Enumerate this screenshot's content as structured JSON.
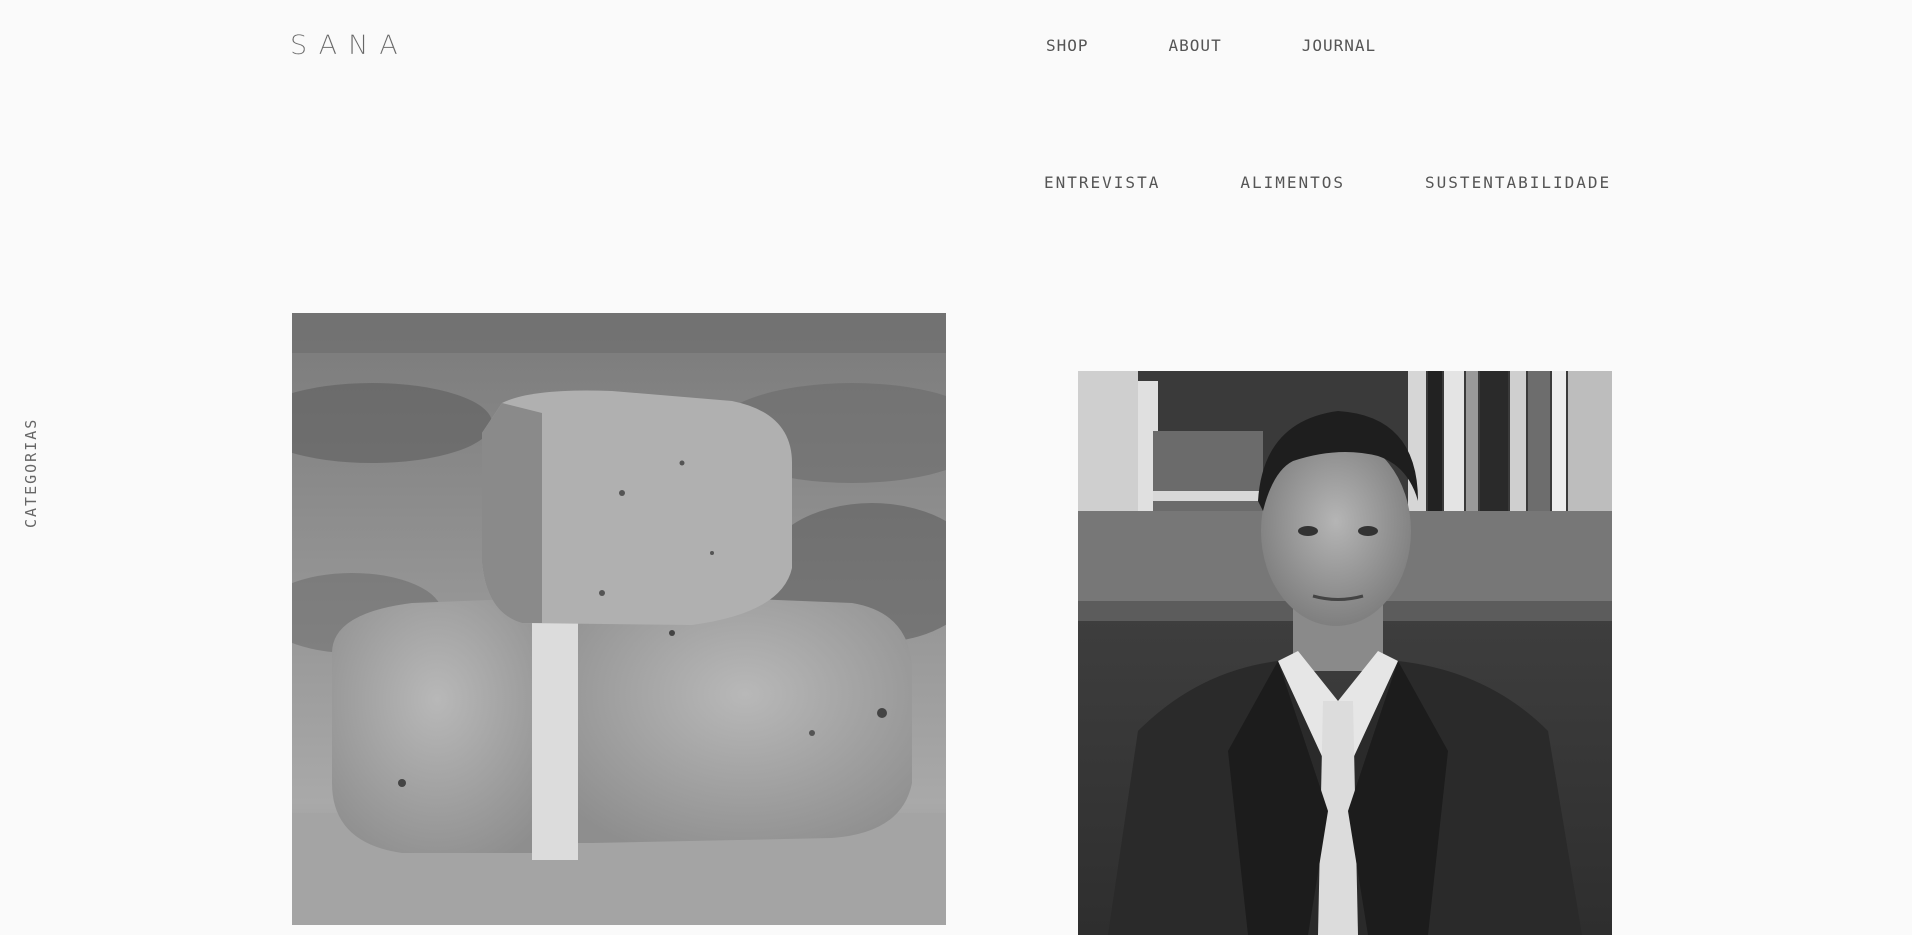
{
  "brand": {
    "logo_text": "SANA"
  },
  "top_nav": {
    "items": [
      {
        "label": "SHOP"
      },
      {
        "label": "ABOUT"
      },
      {
        "label": "JOURNAL"
      }
    ]
  },
  "categories_nav": {
    "items": [
      {
        "label": "ENTREVISTA"
      },
      {
        "label": "ALIMENTOS"
      },
      {
        "label": "SUSTENTABILIDADE"
      }
    ]
  },
  "sidebar": {
    "label": "CATEGORIAS"
  },
  "colors": {
    "background": "#fafafa",
    "text": "#555555"
  }
}
